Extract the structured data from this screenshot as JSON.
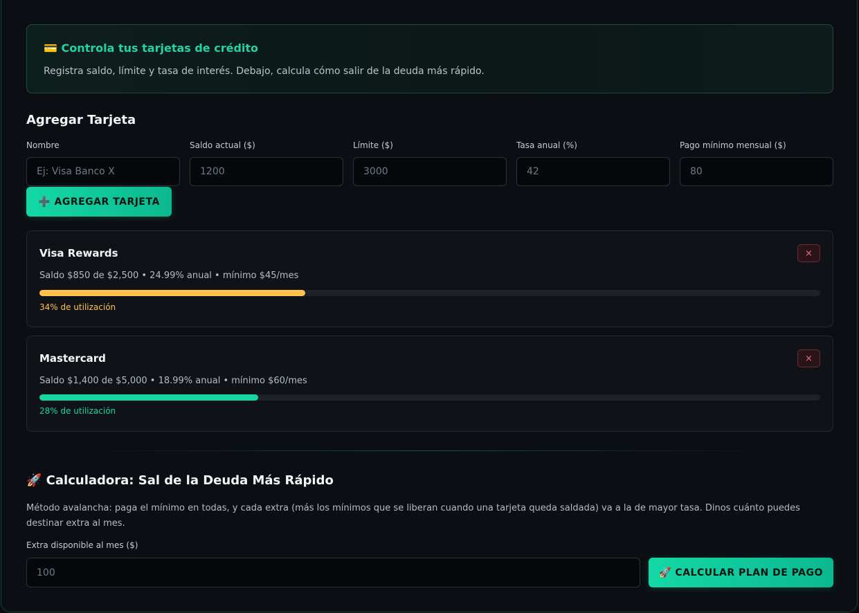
{
  "banner": {
    "icon": "💳",
    "title": "Controla tus tarjetas de crédito",
    "text": "Registra saldo, límite y tasa de interés. Debajo, calcula cómo salir de la deuda más rápido."
  },
  "add_card": {
    "title": "Agregar Tarjeta",
    "fields": [
      {
        "label": "Nombre",
        "placeholder": "Ej: Visa Banco X"
      },
      {
        "label": "Saldo actual ($)",
        "placeholder": "1200"
      },
      {
        "label": "Límite ($)",
        "placeholder": "3000"
      },
      {
        "label": "Tasa anual (%)",
        "placeholder": "42"
      },
      {
        "label": "Pago mínimo mensual ($)",
        "placeholder": "80"
      }
    ],
    "button_label": "➕ AGREGAR TARJETA"
  },
  "cards": [
    {
      "name": "Visa Rewards",
      "details": "Saldo $850 de $2,500 • 24.99% anual • mínimo $45/mes",
      "utilization_pct": 34,
      "utilization_text": "34% de utilización",
      "bar_color": "#ffc24d",
      "close_label": "×"
    },
    {
      "name": "Mastercard",
      "details": "Saldo $1,400 de $5,000 • 18.99% anual • mínimo $60/mes",
      "utilization_pct": 28,
      "utilization_text": "28% de utilización",
      "bar_color": "#18d6a3",
      "close_label": "×"
    }
  ],
  "calculator": {
    "title": "🚀 Calculadora: Sal de la Deuda Más Rápido",
    "description": "Método avalancha: paga el mínimo en todas, y cada extra (más los mínimos que se liberan cuando una tarjeta queda saldada) va a la de mayor tasa. Dinos cuánto puedes destinar extra al mes.",
    "extra_label": "Extra disponible al mes ($)",
    "extra_placeholder": "100",
    "button_label": "🚀 CALCULAR PLAN DE PAGO"
  },
  "colors": {
    "accent": "#22d3a5",
    "danger": "#f07085"
  }
}
